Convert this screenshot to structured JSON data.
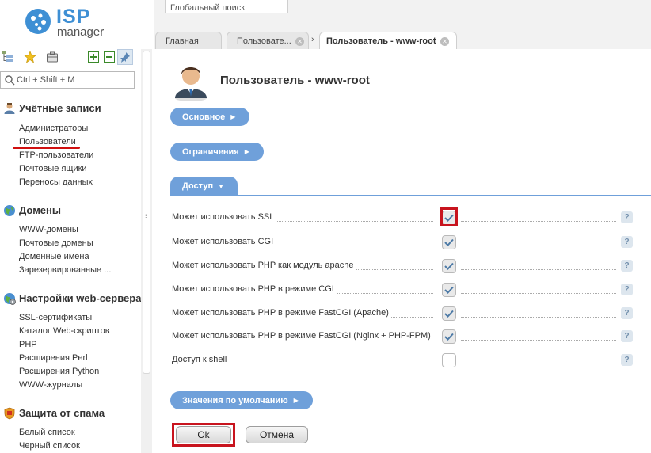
{
  "logo": {
    "brand": "ISP",
    "product": "manager"
  },
  "sidebar": {
    "search_placeholder": "Ctrl + Shift + M",
    "sections": [
      {
        "title": "Учётные записи",
        "icon": "user-accounts-icon",
        "items": [
          "Администраторы",
          "Пользователи",
          "FTP-пользователи",
          "Почтовые ящики",
          "Переносы данных"
        ]
      },
      {
        "title": "Домены",
        "icon": "globe-icon",
        "items": [
          "WWW-домены",
          "Почтовые домены",
          "Доменные имена",
          "Зарезервированные ..."
        ]
      },
      {
        "title": "Настройки web-сервера",
        "icon": "globe-gear-icon",
        "items": [
          "SSL-сертификаты",
          "Каталог Web-скриптов",
          "PHP",
          "Расширения Perl",
          "Расширения Python",
          "WWW-журналы"
        ]
      },
      {
        "title": "Защита от спама",
        "icon": "shield-icon",
        "items": [
          "Белый список",
          "Черный список"
        ]
      }
    ]
  },
  "header": {
    "global_search_placeholder": "Глобальный поиск",
    "tabs": [
      {
        "label": "Главная"
      },
      {
        "label": "Пользовате..."
      },
      {
        "label": "Пользователь - www-root"
      }
    ]
  },
  "form": {
    "title": "Пользователь - www-root",
    "sections": {
      "basic": "Основное",
      "limits": "Ограничения",
      "access": "Доступ",
      "defaults": "Значения по умолчанию"
    },
    "rows": [
      {
        "label": "Может использовать SSL",
        "checked": true
      },
      {
        "label": "Может использовать CGI",
        "checked": true
      },
      {
        "label": "Может использовать PHP как модуль apache",
        "checked": true
      },
      {
        "label": "Может использовать PHP в режиме CGI",
        "checked": true
      },
      {
        "label": "Может использовать PHP в режиме FastCGI (Apache)",
        "checked": true
      },
      {
        "label": "Может использовать PHP в режиме FastCGI (Nginx + PHP-FPM)",
        "checked": true
      },
      {
        "label": "Доступ к shell",
        "checked": false
      }
    ],
    "help_label": "?",
    "ok_label": "Ok",
    "cancel_label": "Отмена"
  },
  "colors": {
    "accent": "#6fa0da",
    "highlight": "#c8141e"
  }
}
